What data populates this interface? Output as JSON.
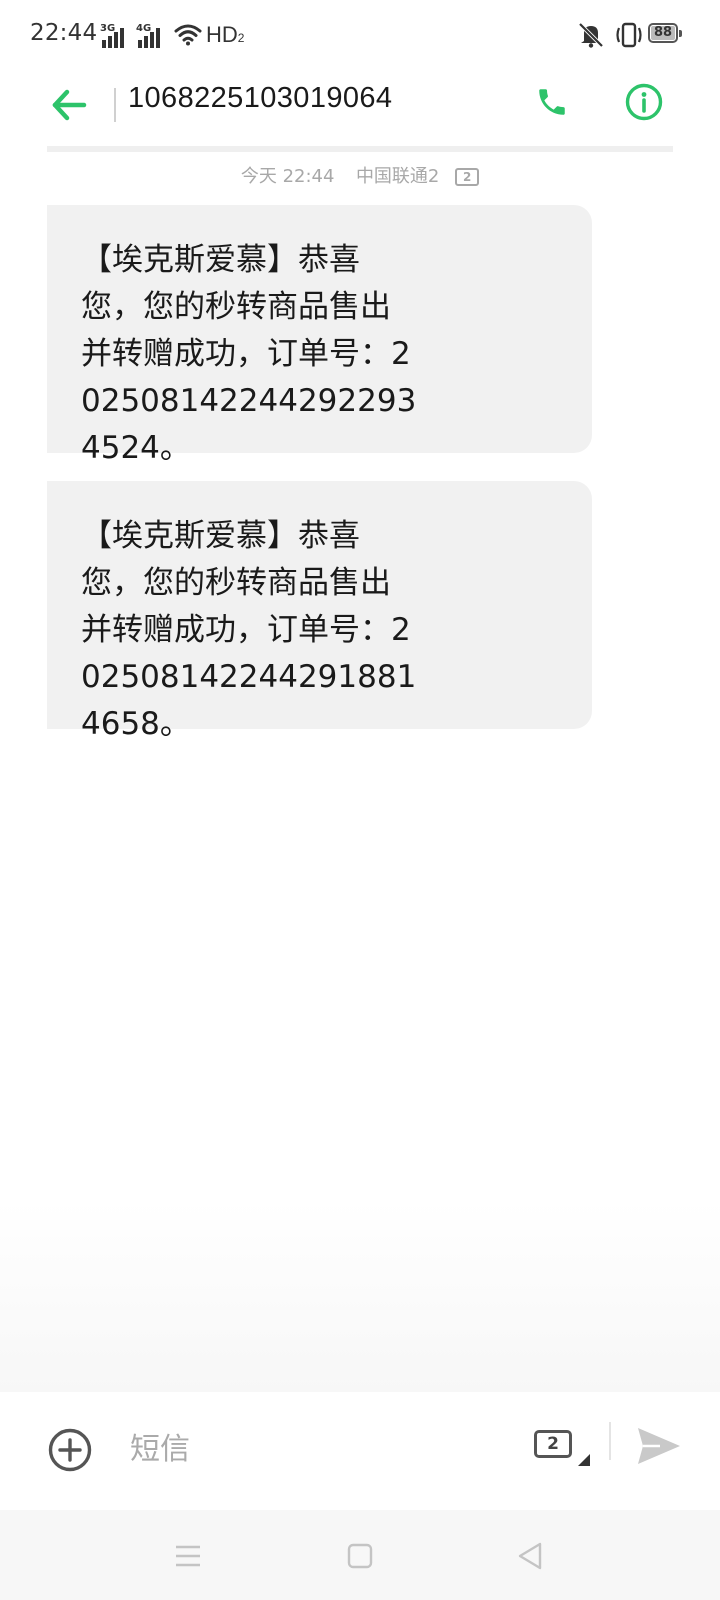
{
  "status_bar": {
    "time": "22:44",
    "signal_1_type": "3G",
    "signal_2_type": "4G",
    "network": "HD",
    "network_sub": "2",
    "battery_level": "88"
  },
  "header": {
    "contact_number": "1068225103019064"
  },
  "thread": {
    "meta": {
      "date": "今天 22:44",
      "carrier": "中国联通2",
      "sim": "2"
    },
    "messages": [
      {
        "text": "【埃克斯爱慕】恭喜您，您的秒转商品售出并转赠成功，订单号：20250814224429​22934524。"
      },
      {
        "text": "【埃克斯爱慕】恭喜您，您的秒转商品售出并转赠成功，订单号：20250814224429​18814658。"
      }
    ]
  },
  "composer": {
    "placeholder": "短信",
    "sim": "2"
  },
  "colors": {
    "accent": "#2dc36a",
    "bubble": "#f1f1f1"
  }
}
